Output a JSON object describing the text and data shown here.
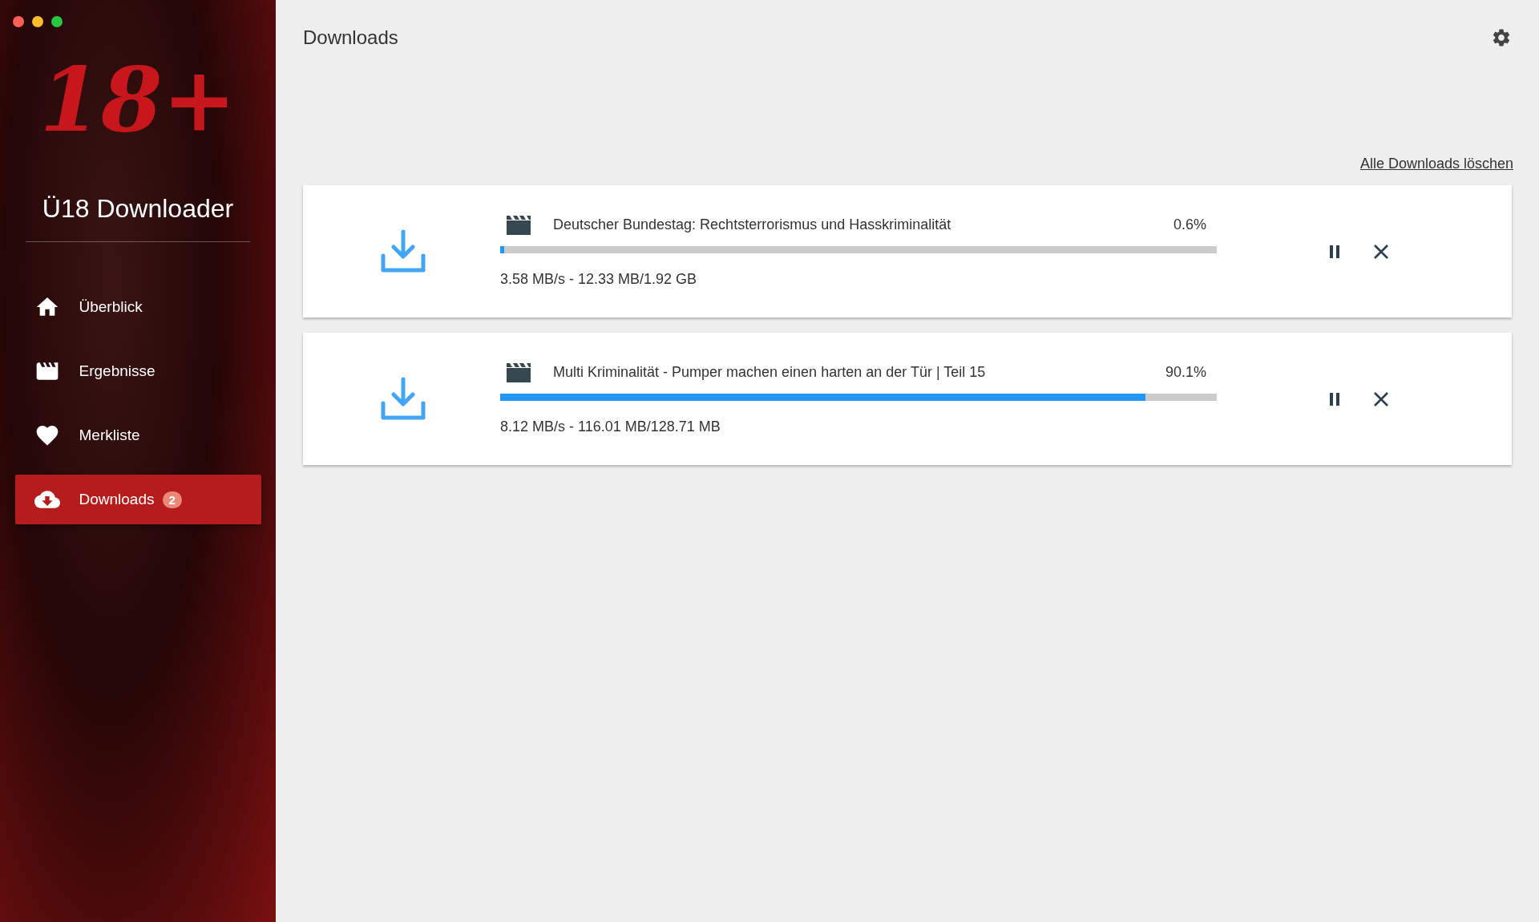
{
  "sidebar": {
    "logo": "18+",
    "title": "Ü18 Downloader",
    "items": [
      {
        "label": "Überblick",
        "kind": "home",
        "selected": false
      },
      {
        "label": "Ergebnisse",
        "kind": "film",
        "selected": false
      },
      {
        "label": "Merkliste",
        "kind": "heart",
        "selected": false
      },
      {
        "label": "Downloads",
        "kind": "cloud",
        "selected": true,
        "badge": "2"
      }
    ]
  },
  "header": {
    "title": "Downloads"
  },
  "clear_link": "Alle Downloads löschen",
  "downloads": [
    {
      "title": "Deutscher Bundestag: Rechtsterrorismus und Hasskriminalität",
      "percent": "0.6%",
      "level": 0.006,
      "stats": "3.58 MB/s - 12.33 MB/1.92 GB"
    },
    {
      "title": "Multi Kriminalität - Pumper machen einen harten an der Tür | Teil 15",
      "percent": "90.1%",
      "level": 0.901,
      "stats": "8.12 MB/s - 116.01 MB/128.71 MB"
    }
  ]
}
